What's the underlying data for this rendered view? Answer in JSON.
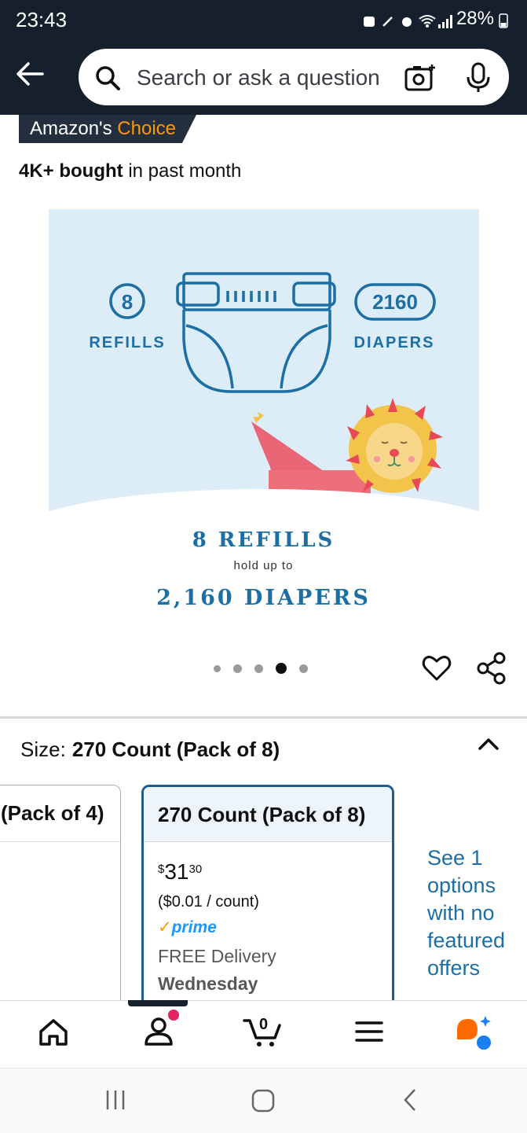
{
  "status_bar": {
    "time": "23:43",
    "battery": "28%"
  },
  "search": {
    "placeholder": "Search or ask a question"
  },
  "badge": {
    "prefix": "Amazon's ",
    "highlight": "Choice"
  },
  "social_proof": {
    "bold": "4K+ bought",
    "rest": " in past month"
  },
  "product_image": {
    "refills_count": "8",
    "refills_label": "REFILLS",
    "diapers_count": "2160",
    "diapers_label": "DIAPERS",
    "caption_line1": "8 REFILLS",
    "caption_line2": "hold up to",
    "caption_line3": "2,160 DIAPERS"
  },
  "carousel": {
    "count": 5,
    "active_index": 3
  },
  "size": {
    "label": "Size:",
    "selected": "270 Count (Pack of 8)",
    "options": [
      {
        "label": "(Pack of 4)"
      },
      {
        "label": "270 Count (Pack of 8)",
        "price_currency": "$",
        "price_whole": "31",
        "price_fraction": "30",
        "unit_price": "($0.01 / count)",
        "prime_label": "prime",
        "delivery": "FREE Delivery",
        "delivery_day": "Wednesday"
      }
    ],
    "see_options": "See 1 options with no featured offers"
  },
  "bottom_nav": {
    "cart_count": "0"
  },
  "colors": {
    "header": "#16202d",
    "accent": "#ff9900",
    "link": "#1d6fa3",
    "selected_border": "#1d5d90",
    "image_bg": "#dcedf8"
  }
}
